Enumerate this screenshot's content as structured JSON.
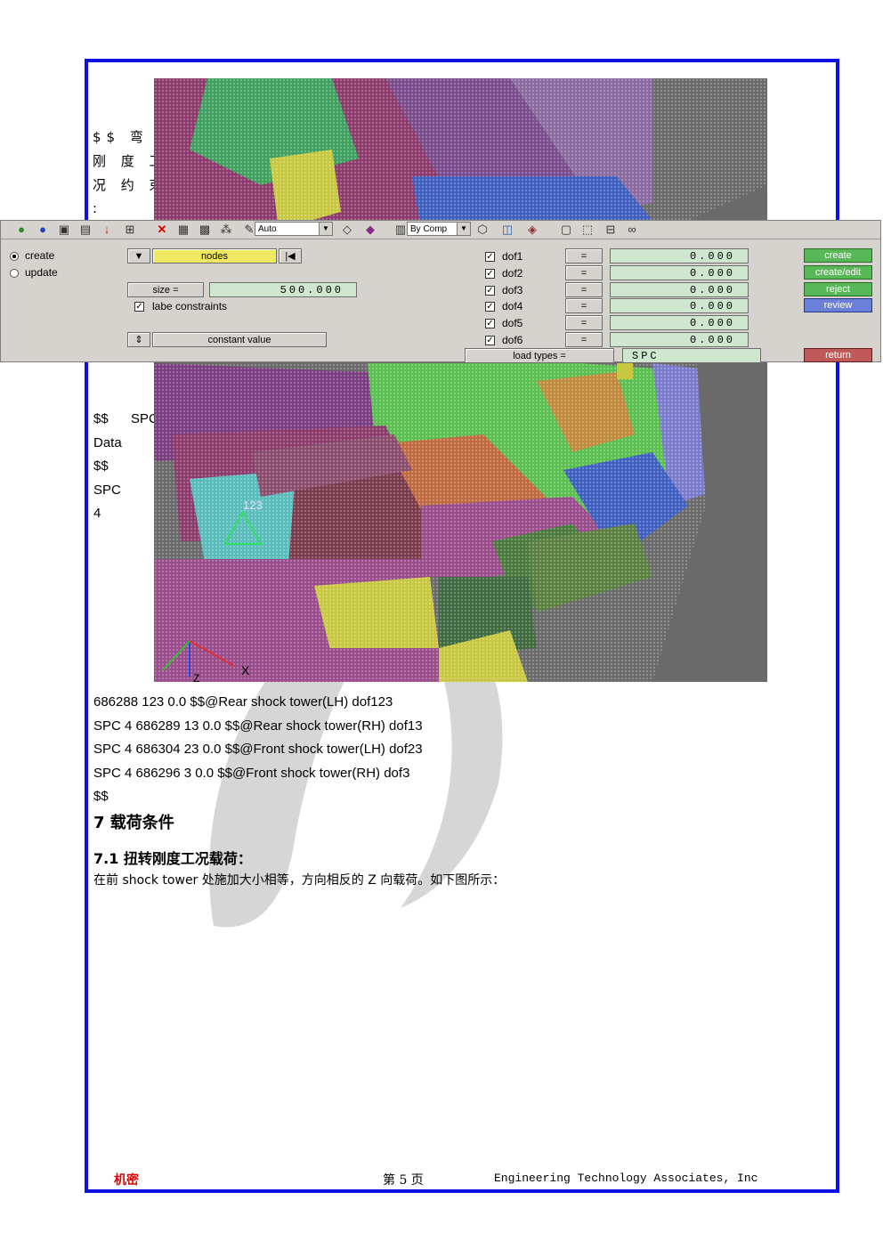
{
  "side_text": {
    "line1": "$$ 弯 曲",
    "line2": "刚 度 工",
    "line3": "况 约 束",
    "line4": ":",
    "spc_line_a": "$$",
    "spc_line_b": "SPC",
    "data_line": "Data",
    "dd_line": "$$",
    "spc_line_c": "SPC",
    "four_line": "4"
  },
  "viewport": {
    "node_label": "123",
    "axis_x": "X",
    "axis_z": "Z"
  },
  "panel": {
    "toolbar": {
      "auto_combo": "Auto",
      "bycomp_combo": "By Comp"
    },
    "mode": {
      "create_label": "create",
      "update_label": "update"
    },
    "nodes_selector": "nodes",
    "size_label": "size =",
    "size_value": "500.000",
    "label_constraints": "labe constraints",
    "constant_value": "constant value",
    "dofs": [
      {
        "label": "dof1",
        "eq": "=",
        "value": "0.000"
      },
      {
        "label": "dof2",
        "eq": "=",
        "value": "0.000"
      },
      {
        "label": "dof3",
        "eq": "=",
        "value": "0.000"
      },
      {
        "label": "dof4",
        "eq": "=",
        "value": "0.000"
      },
      {
        "label": "dof5",
        "eq": "=",
        "value": "0.000"
      },
      {
        "label": "dof6",
        "eq": "=",
        "value": "0.000"
      }
    ],
    "load_types_label": "load types =",
    "load_types_value": "SPC",
    "actions": {
      "create": "create",
      "create_edit": "create/edit",
      "reject": "reject",
      "review": "review",
      "return": "return"
    }
  },
  "card_lines": [
    "686288  123   0.0     $$@Rear shock tower(LH) dof123",
    "SPC          4  686289  13    0.0     $$@Rear shock tower(RH) dof13",
    "SPC          4  686304  23    0.0     $$@Front shock tower(LH) dof23",
    "SPC          4  686296  3     0.0     $$@Front shock tower(RH) dof3",
    "$$"
  ],
  "section": {
    "heading7": "7    载荷条件",
    "heading71": "7.1 扭转刚度工况载荷：",
    "body": "在前 shock tower 处施加大小相等，方向相反的 Z 向载荷。如下图所示："
  },
  "footer": {
    "confidential": "机密",
    "page": "第 5 页",
    "company": "Engineering Technology Associates, Inc"
  }
}
